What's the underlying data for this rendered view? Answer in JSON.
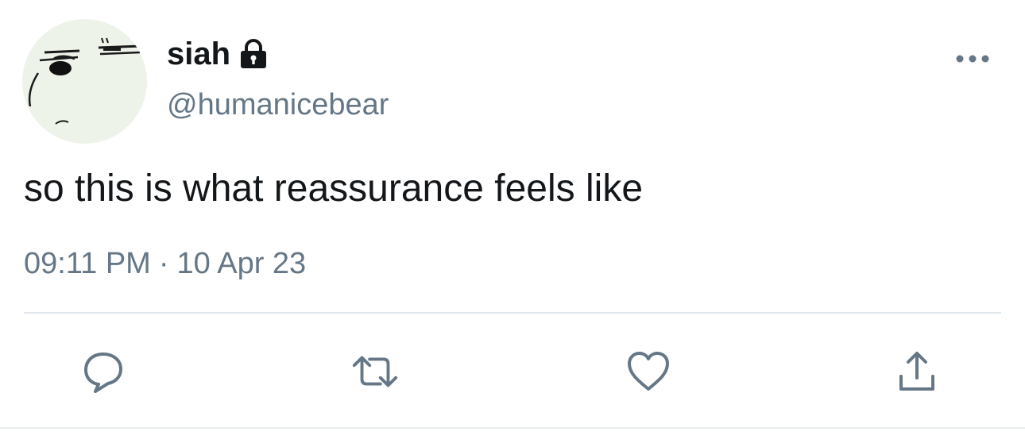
{
  "tweet": {
    "author": {
      "display_name": "siah",
      "handle": "@humanicebear",
      "avatar_icon": "bear-face-avatar",
      "protected_icon": "lock-icon"
    },
    "text": "so this is what reassurance feels like",
    "time": "09:11 PM",
    "separator": "·",
    "date": "10 Apr 23"
  },
  "actions": {
    "reply_icon": "reply-icon",
    "retweet_icon": "retweet-icon",
    "like_icon": "heart-icon",
    "share_icon": "share-icon",
    "more_icon": "more-icon"
  },
  "colors": {
    "text": "#14171a",
    "secondary": "#657786",
    "divider": "#e1e8ed"
  }
}
